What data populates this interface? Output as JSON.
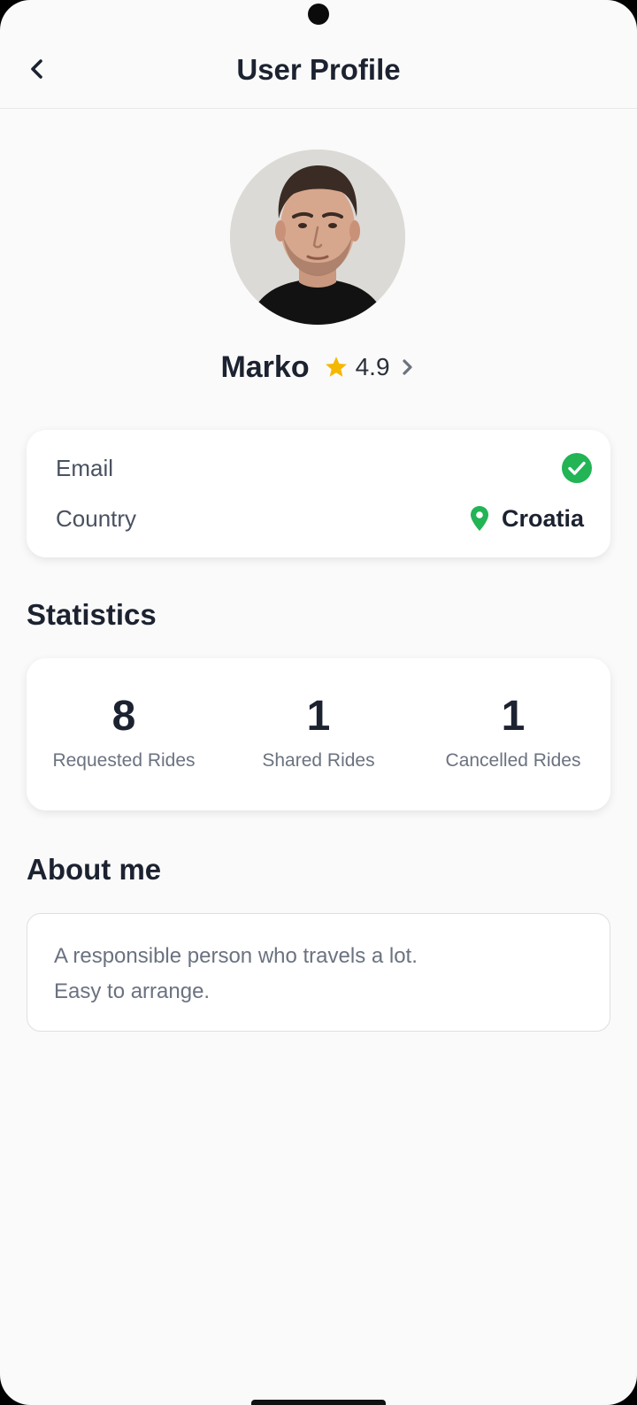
{
  "header": {
    "title": "User Profile",
    "back_icon": "chevron-left-icon"
  },
  "profile": {
    "name": "Marko",
    "rating": "4.9",
    "rating_icon": "star-icon",
    "rating_color": "#f5b800"
  },
  "info": {
    "email_label": "Email",
    "email_status_icon": "check-circle-icon",
    "verified_color": "#22b455",
    "country_label": "Country",
    "country_icon": "location-pin-icon",
    "country_value": "Croatia"
  },
  "statistics": {
    "title": "Statistics",
    "items": [
      {
        "value": "8",
        "label": "Requested Rides"
      },
      {
        "value": "1",
        "label": "Shared Rides"
      },
      {
        "value": "1",
        "label": "Cancelled Rides"
      }
    ]
  },
  "about": {
    "title": "About me",
    "lines": [
      "A responsible person who travels a lot.",
      "Easy to arrange."
    ]
  }
}
